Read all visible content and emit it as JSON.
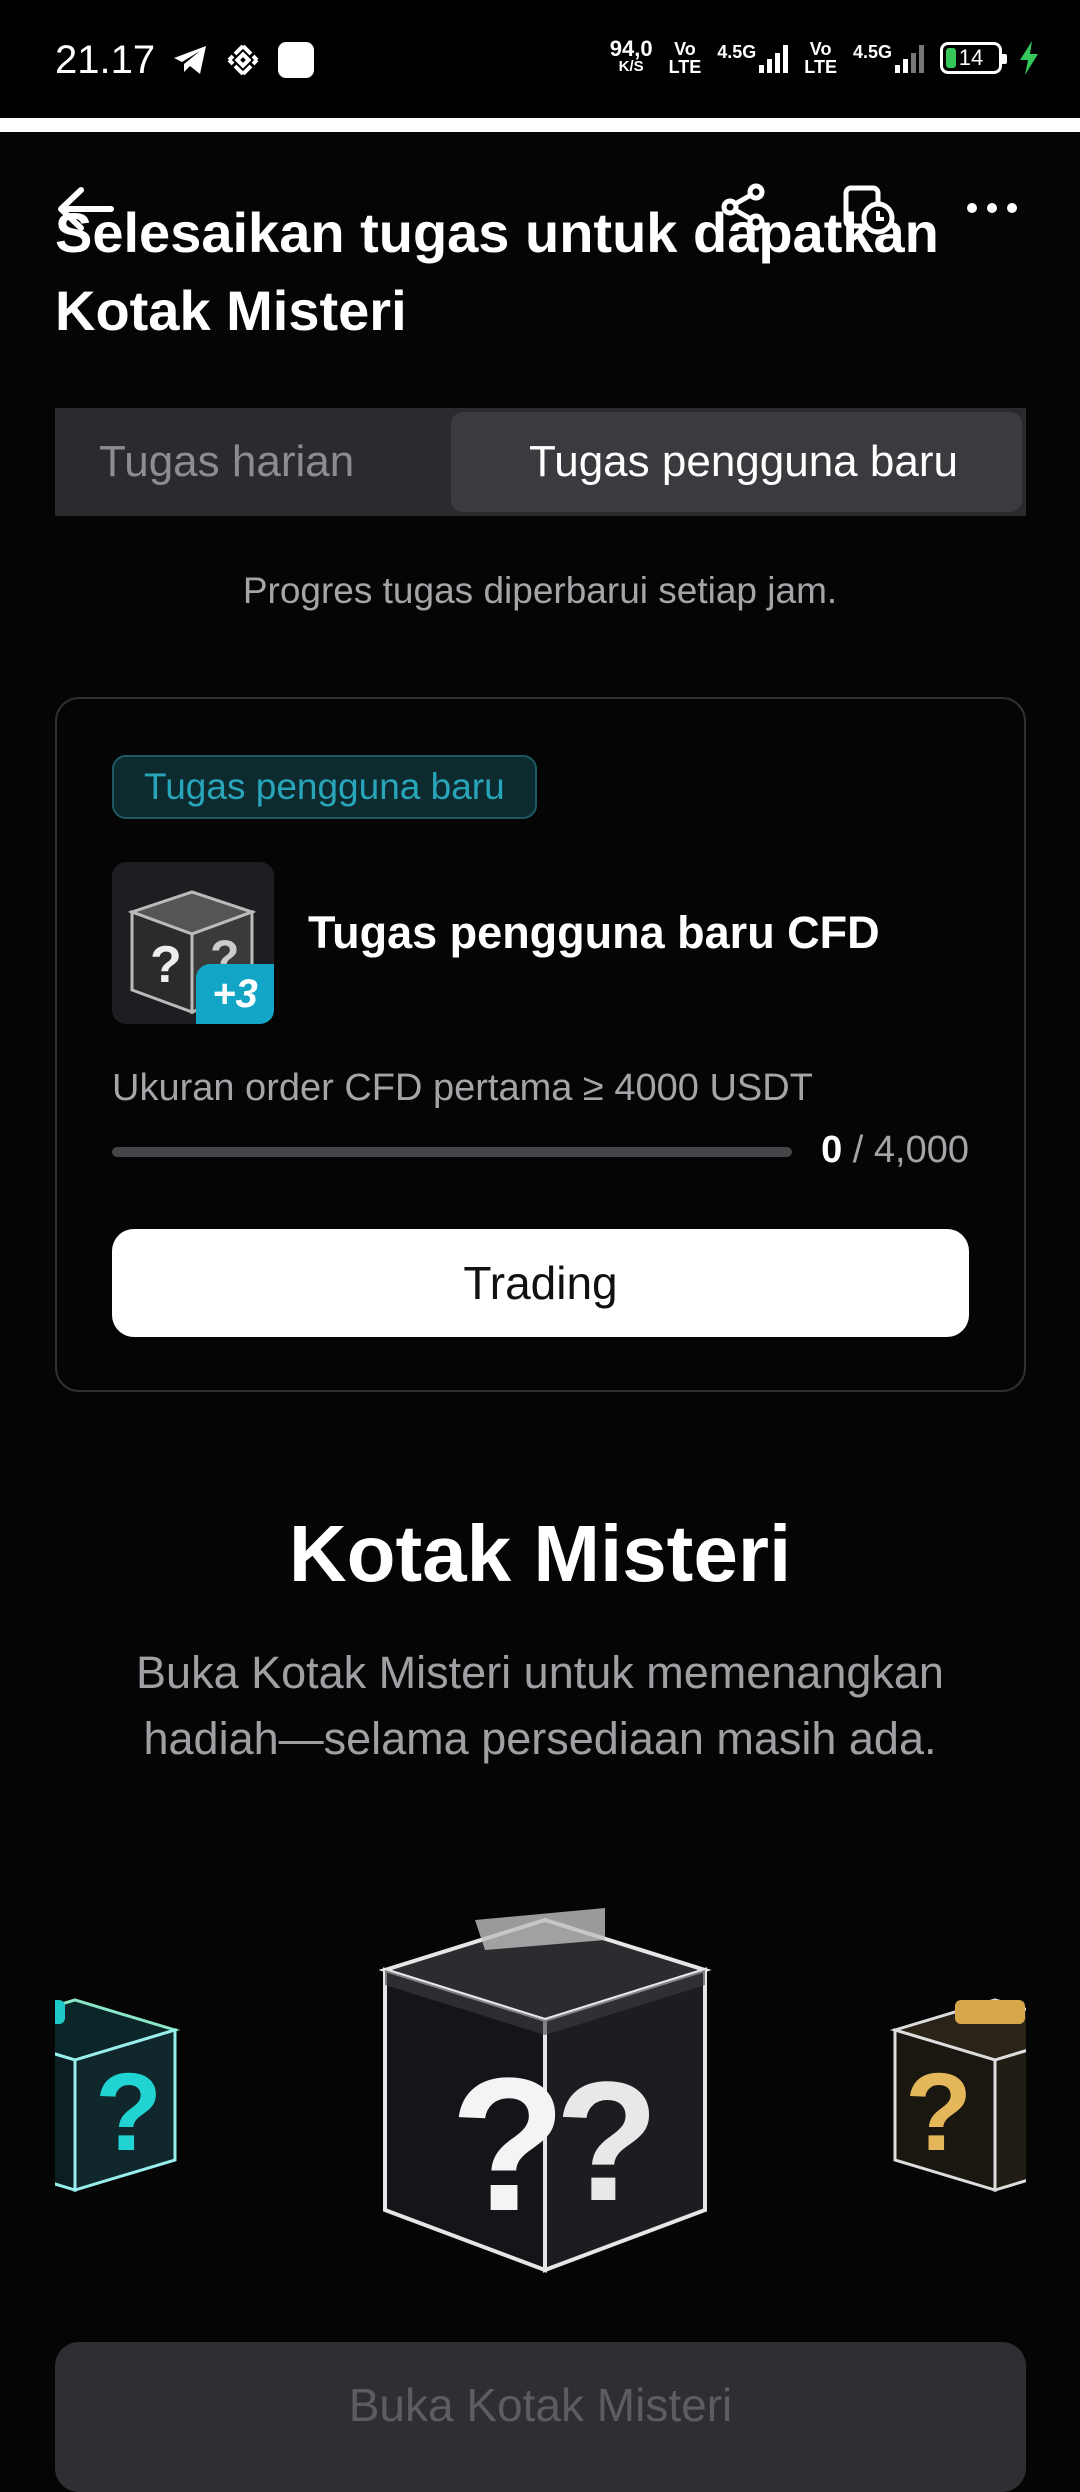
{
  "status_bar": {
    "time": "21.17",
    "net_speed_value": "94,0",
    "net_speed_unit": "K/S",
    "sim1_top": "Vo",
    "sim1_bottom": "LTE",
    "sim1_net": "4.5G",
    "sim2_top": "Vo",
    "sim2_bottom": "LTE",
    "sim2_net": "4.5G",
    "battery": "14"
  },
  "header": {
    "title": "Selesaikan tugas untuk dapatkan Kotak Misteri",
    "icons": [
      "back-arrow-icon",
      "share-icon",
      "history-icon",
      "more-icon"
    ]
  },
  "tabs": [
    {
      "label": "Tugas harian",
      "selected": false
    },
    {
      "label": "Tugas pengguna baru",
      "selected": true
    }
  ],
  "hint": "Progres tugas diperbarui setiap jam.",
  "task": {
    "badge": "Tugas pengguna baru",
    "reward": "+3",
    "title": "Tugas pengguna baru CFD",
    "condition": "Ukuran order CFD pertama ≥ 4000 USDT",
    "progress_current": "0",
    "progress_separator": "/",
    "progress_target": "4,000",
    "progress_fraction": 0,
    "button": "Trading"
  },
  "mystery": {
    "title": "Kotak Misteri",
    "description": "Buka Kotak Misteri untuk memenangkan hadiah—selama persediaan masih ada.",
    "button": "Buka Kotak Misteri"
  },
  "colors": {
    "accent": "#12a5c6",
    "background": "#050505",
    "badge_text": "#29a5ba"
  }
}
